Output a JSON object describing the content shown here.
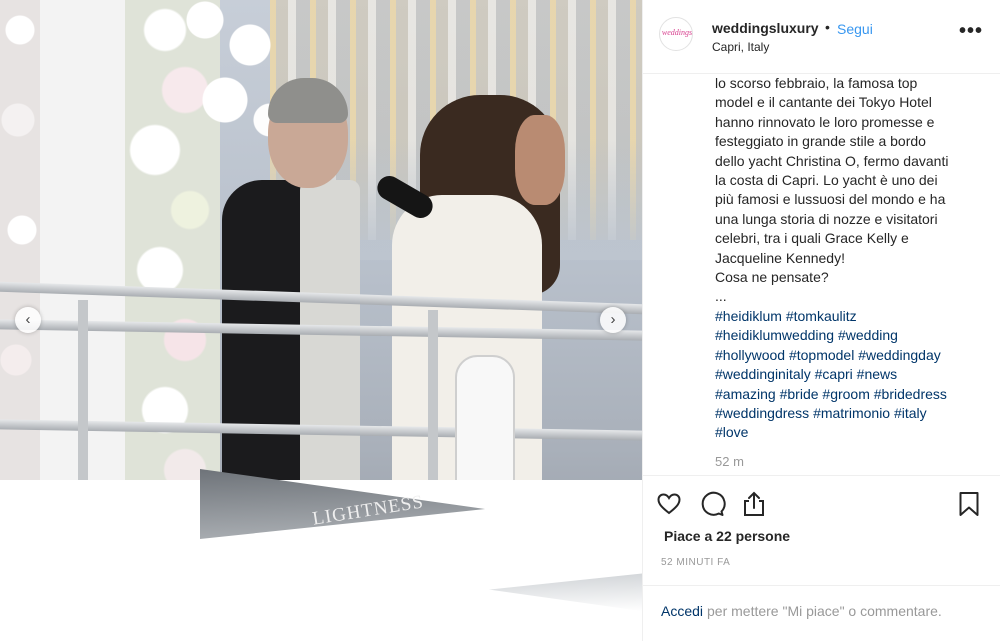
{
  "post": {
    "photo_overlay_text": "LIGHTNESS"
  },
  "header": {
    "username": "weddingsluxury",
    "separator": "•",
    "follow_label": "Segui",
    "location": "Capri, Italy",
    "more_label": "•••",
    "avatar_text": "weddings"
  },
  "caption": {
    "lines": [
      "lo scorso febbraio, la famosa top",
      "model e il cantante dei Tokyo Hotel",
      "hanno rinnovato le loro promesse e",
      "festeggiato in grande stile a bordo",
      "dello yacht Christina O, fermo davanti",
      "la costa di Capri. Lo yacht è uno dei",
      "più famosi e lussuosi del mondo e ha",
      "una lunga storia di nozze e visitatori",
      "celebri, tra i quali Grace Kelly e",
      "Jacqueline Kennedy!",
      "Cosa ne pensate?",
      "..."
    ],
    "hashtag_lines": [
      [
        "#heidiklum",
        "#tomkaulitz"
      ],
      [
        "#heidiklumwedding",
        "#wedding"
      ],
      [
        "#hollywood",
        "#topmodel",
        "#weddingday"
      ],
      [
        "#weddinginitaly",
        "#capri",
        "#news"
      ],
      [
        "#amazing",
        "#bride",
        "#groom",
        "#bridedress"
      ],
      [
        "#weddingdress",
        "#matrimonio",
        "#italy"
      ],
      [
        "#love"
      ]
    ],
    "time_ago": "52 m"
  },
  "actions": {
    "icons": [
      "heart-icon",
      "comment-icon",
      "share-icon",
      "bookmark-icon"
    ]
  },
  "likes": "Piace a 22 persone",
  "timestamp": "52 MINUTI FA",
  "login": {
    "link": "Accedi",
    "text": "per mettere \"Mi piace\" o commentare."
  },
  "colors": {
    "link_blue": "#3897f0",
    "hashtag_blue": "#003569",
    "muted": "#999999",
    "text": "#262626"
  }
}
